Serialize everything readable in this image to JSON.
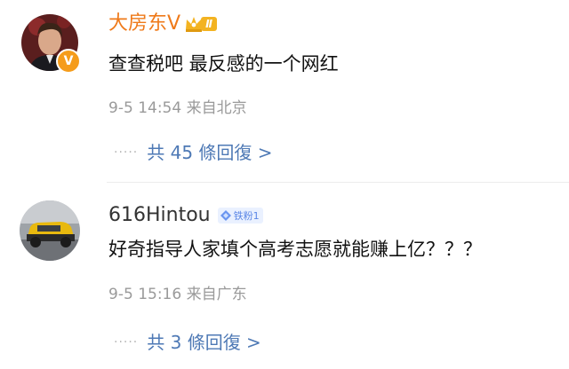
{
  "comments": [
    {
      "username": "大房东V",
      "level_badge": "Ⅱ",
      "text": "查查税吧 最反感的一个网红",
      "date": "9-5",
      "time": "14:54",
      "location": "来自北京",
      "replies": "共 45 條回復 >",
      "verified_mark": "V",
      "name_color": "#ef7a1a"
    },
    {
      "username": "616Hintou",
      "fans_badge": "铁粉1",
      "text": "好奇指导人家填个高考志愿就能赚上亿？？？",
      "date": "9-5",
      "time": "15:16",
      "location": "来自广东",
      "replies": "共 3 條回復 >",
      "name_color": "#333333"
    }
  ],
  "ellipsis": "·····",
  "colors": {
    "link": "#4e79b5",
    "meta": "#9a9a9a",
    "orange": "#ef7a1a",
    "badge_gold": "#f3b321"
  },
  "icons": {
    "crown": "crown-icon",
    "fans": "diamond-icon",
    "verified": "verified-v-icon"
  }
}
